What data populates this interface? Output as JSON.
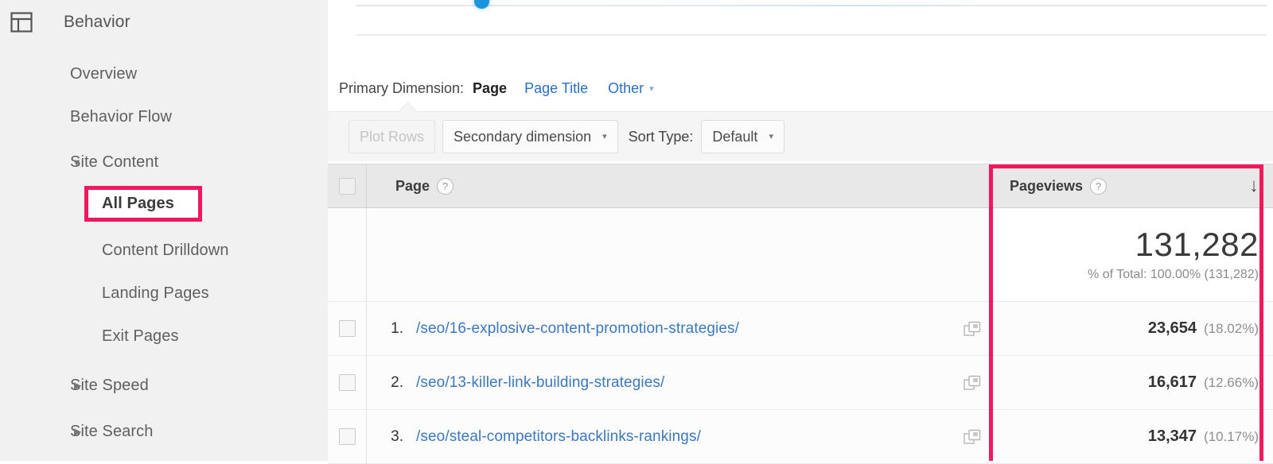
{
  "accent": {
    "highlight_pink": "#f3185e",
    "link_blue": "#3b78bd",
    "chart_point_blue": "#1a94dd"
  },
  "sidebar": {
    "section": {
      "icon": "behavior-layout-icon",
      "title": "Behavior"
    },
    "items": [
      {
        "label": "Overview",
        "level": 1,
        "caret": "",
        "selected": false
      },
      {
        "label": "Behavior Flow",
        "level": 1,
        "caret": "",
        "selected": false
      },
      {
        "label": "Site Content",
        "level": 2,
        "caret": "down",
        "selected": false
      },
      {
        "label": "All Pages",
        "level": 3,
        "caret": "",
        "selected": true
      },
      {
        "label": "Content Drilldown",
        "level": 3,
        "caret": "",
        "selected": false
      },
      {
        "label": "Landing Pages",
        "level": 3,
        "caret": "",
        "selected": false
      },
      {
        "label": "Exit Pages",
        "level": 3,
        "caret": "",
        "selected": false
      },
      {
        "label": "Site Speed",
        "level": 2,
        "caret": "right",
        "selected": false
      },
      {
        "label": "Site Search",
        "level": 2,
        "caret": "right",
        "selected": false
      }
    ]
  },
  "primary_dimension": {
    "label": "Primary Dimension:",
    "active": "Page",
    "links": [
      "Page Title"
    ],
    "other": "Other",
    "other_caret": "▾"
  },
  "toolbar": {
    "plot_rows": "Plot Rows",
    "secondary_dimension": "Secondary dimension",
    "secondary_caret": "▾",
    "sort_type_label": "Sort Type:",
    "sort_type_value": "Default",
    "sort_caret": "▾"
  },
  "table": {
    "columns": {
      "page": "Page",
      "pageviews": "Pageviews",
      "help_glyph": "?",
      "sort_glyph": "↓"
    },
    "total": {
      "value": "131,282",
      "subtext": "% of Total: 100.00% (131,282)"
    },
    "rows": [
      {
        "rank": "1.",
        "page": "/seo/16-explosive-content-promotion-strategies/",
        "pageviews": "23,654",
        "percent": "(18.02%)"
      },
      {
        "rank": "2.",
        "page": "/seo/13-killer-link-building-strategies/",
        "pageviews": "16,617",
        "percent": "(12.66%)"
      },
      {
        "rank": "3.",
        "page": "/seo/steal-competitors-backlinks-rankings/",
        "pageviews": "13,347",
        "percent": "(10.17%)"
      }
    ]
  }
}
